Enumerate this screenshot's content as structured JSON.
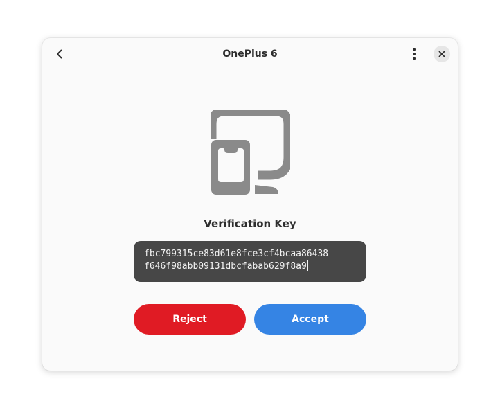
{
  "window": {
    "title": "OnePlus 6"
  },
  "header": {
    "back_icon": "chevron-left-icon",
    "menu_icon": "vertical-dots-menu-icon",
    "close_icon": "close-icon"
  },
  "main": {
    "device_icon": "phone-and-computer-icon",
    "heading": "Verification Key",
    "key_line_1": "fbc799315ce83d61e8fce3cf4bcaa86438",
    "key_line_2": "f646f98abb09131dbcfabab629f8a9"
  },
  "actions": {
    "reject_label": "Reject",
    "accept_label": "Accept"
  },
  "colors": {
    "reject": "#e01b24",
    "accept": "#3584e4",
    "key_box": "#474747",
    "icon": "#8a8a8a"
  }
}
